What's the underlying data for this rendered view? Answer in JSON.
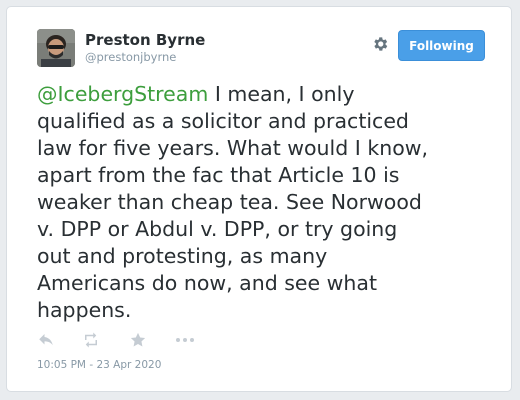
{
  "author": {
    "display_name": "Preston Byrne",
    "handle": "@prestonjbyrne"
  },
  "follow_button": {
    "label": "Following"
  },
  "tweet": {
    "mention": "@IcebergStream",
    "lines": [
      " I mean, I only",
      "qualified as a solicitor and practiced",
      "law for five years. What would I know,",
      "apart from the fac that Article 10 is",
      "weaker than cheap tea. See Norwood",
      "v. DPP or Abdul v. DPP, or try going",
      "out and protesting, as many",
      "Americans do now, and see what",
      "happens."
    ],
    "timestamp": "10:05 PM - 23 Apr 2020"
  },
  "icons": {
    "settings": "gear-icon",
    "reply": "reply-icon",
    "retweet": "retweet-icon",
    "favorite": "star-icon",
    "more": "more-icon"
  },
  "colors": {
    "mention": "#3d9e3d",
    "button": "#4a9fe8",
    "text": "#292f33",
    "muted": "#8899a6",
    "action_icon": "#c5ccd3"
  }
}
